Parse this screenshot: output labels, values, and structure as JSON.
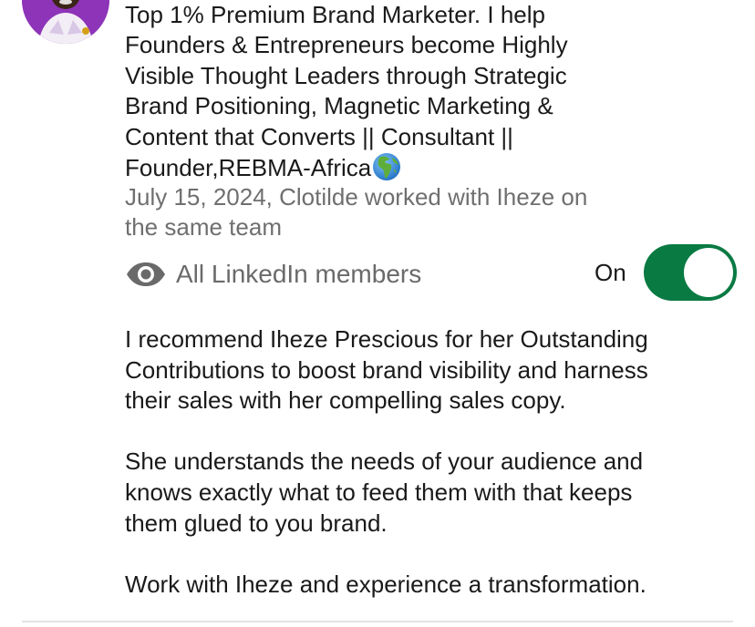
{
  "recommendation": {
    "headline_lines": [
      "Top 1% Premium Brand Marketer. I help",
      "Founders & Entrepreneurs become Highly",
      "Visible Thought Leaders through Strategic",
      "Brand Positioning, Magnetic Marketing &",
      "Content that Converts || Consultant ||",
      "Founder,REBMA-Africa"
    ],
    "headline_emoji": "globe-europe-africa-icon",
    "meta_lines": [
      "July 15, 2024, Clotilde worked with Iheze on",
      "the same team"
    ],
    "visibility": {
      "icon": "eye-icon",
      "label": "All LinkedIn members",
      "toggle_state_label": "On",
      "toggle_on": true
    },
    "body_paragraphs": [
      {
        "lines": [
          "I recommend Iheze Prescious for her Outstanding",
          "Contributions to boost brand visibility and harness",
          "their sales with her compelling sales copy."
        ]
      },
      {
        "lines": [
          "She understands the needs of your audience and",
          "knows exactly what to feed them with that keeps",
          "them glued to you brand."
        ]
      },
      {
        "lines": [
          "Work with Iheze and experience a transformation."
        ]
      }
    ]
  },
  "colors": {
    "toggle_on": "#0a7a43",
    "primary_text": "#1a1a1a",
    "secondary_text": "#6f6f6f",
    "avatar_bg": "#9a3ec0"
  }
}
